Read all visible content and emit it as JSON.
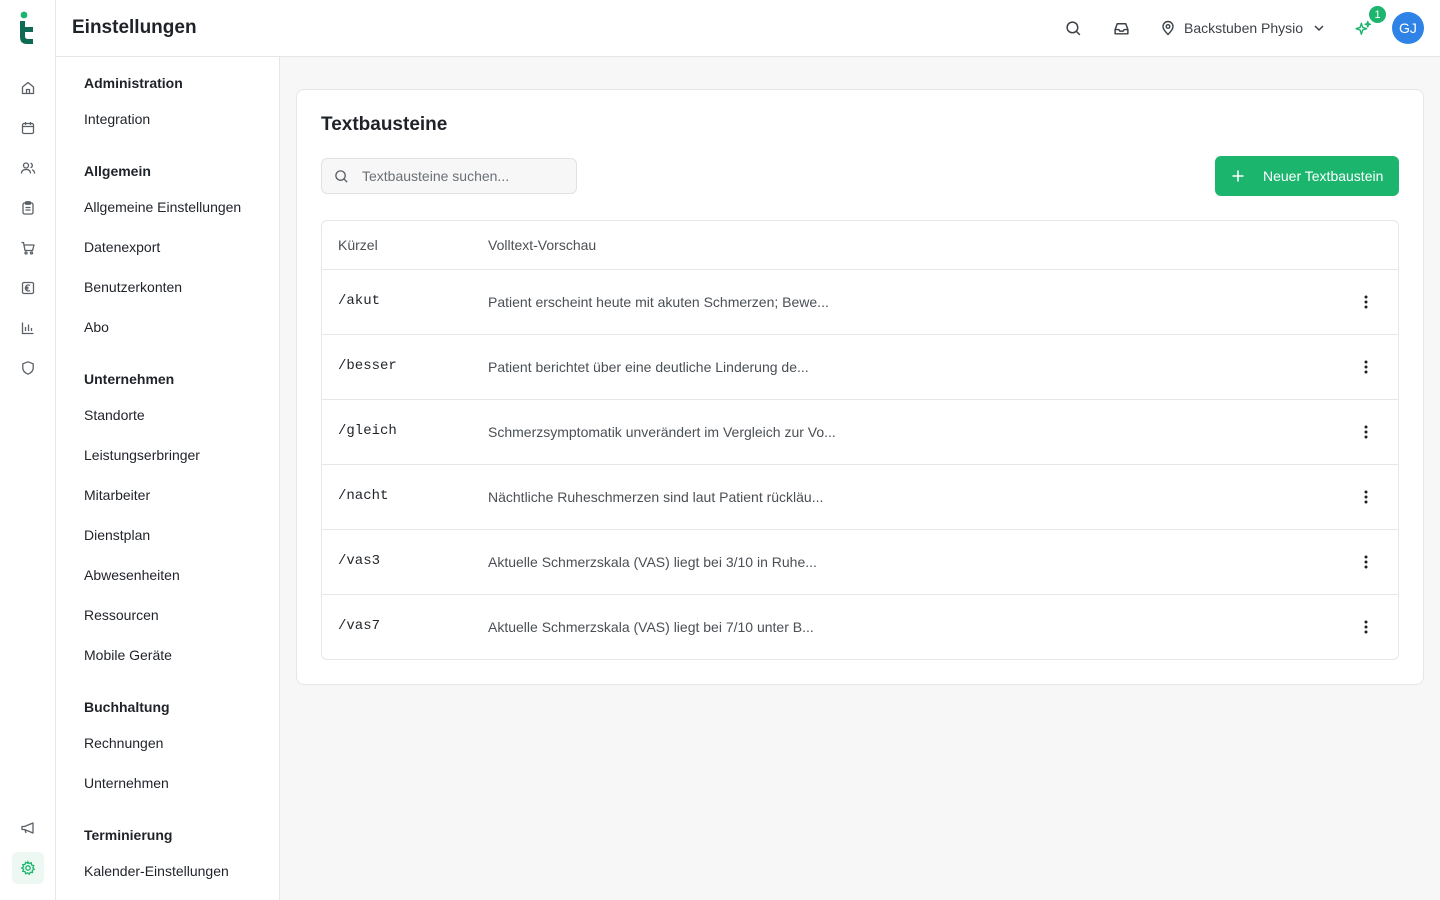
{
  "header": {
    "page_title": "Einstellungen",
    "location": "Backstuben Physio",
    "notification_count": "1",
    "avatar_initials": "GJ"
  },
  "rail": {
    "items": [
      "home",
      "calendar",
      "users",
      "clipboard",
      "cart",
      "euro",
      "chart",
      "shield"
    ],
    "bottom_items": [
      "megaphone",
      "settings"
    ],
    "active": "settings"
  },
  "subnav": {
    "sections": [
      {
        "title": "Administration",
        "items": [
          "Integration"
        ]
      },
      {
        "title": "Allgemein",
        "items": [
          "Allgemeine Einstellungen",
          "Datenexport",
          "Benutzerkonten",
          "Abo"
        ]
      },
      {
        "title": "Unternehmen",
        "items": [
          "Standorte",
          "Leistungserbringer",
          "Mitarbeiter",
          "Dienstplan",
          "Abwesenheiten",
          "Ressourcen",
          "Mobile Geräte"
        ]
      },
      {
        "title": "Buchhaltung",
        "items": [
          "Rechnungen",
          "Unternehmen"
        ]
      },
      {
        "title": "Terminierung",
        "items": [
          "Kalender-Einstellungen"
        ]
      }
    ]
  },
  "main": {
    "title": "Textbausteine",
    "search_placeholder": "Textbausteine suchen...",
    "new_button_label": "Neuer Textbaustein",
    "table": {
      "columns": [
        "Kürzel",
        "Volltext-Vorschau"
      ],
      "rows": [
        {
          "shortcut": "/akut",
          "preview": "Patient erscheint heute mit akuten Schmerzen; Bewe..."
        },
        {
          "shortcut": "/besser",
          "preview": "Patient berichtet über eine deutliche Linderung de..."
        },
        {
          "shortcut": "/gleich",
          "preview": "Schmerzsymptomatik unverändert im Vergleich zur Vo..."
        },
        {
          "shortcut": "/nacht",
          "preview": "Nächtliche Ruheschmerzen sind laut Patient rückläu..."
        },
        {
          "shortcut": "/vas3",
          "preview": "Aktuelle Schmerzskala (VAS) liegt bei 3/10 in Ruhe..."
        },
        {
          "shortcut": "/vas7",
          "preview": "Aktuelle Schmerzskala (VAS) liegt bei 7/10 unter B..."
        }
      ]
    }
  },
  "colors": {
    "accent": "#1bb56e",
    "avatar": "#2f82e6",
    "logo": "#0d6b53"
  }
}
